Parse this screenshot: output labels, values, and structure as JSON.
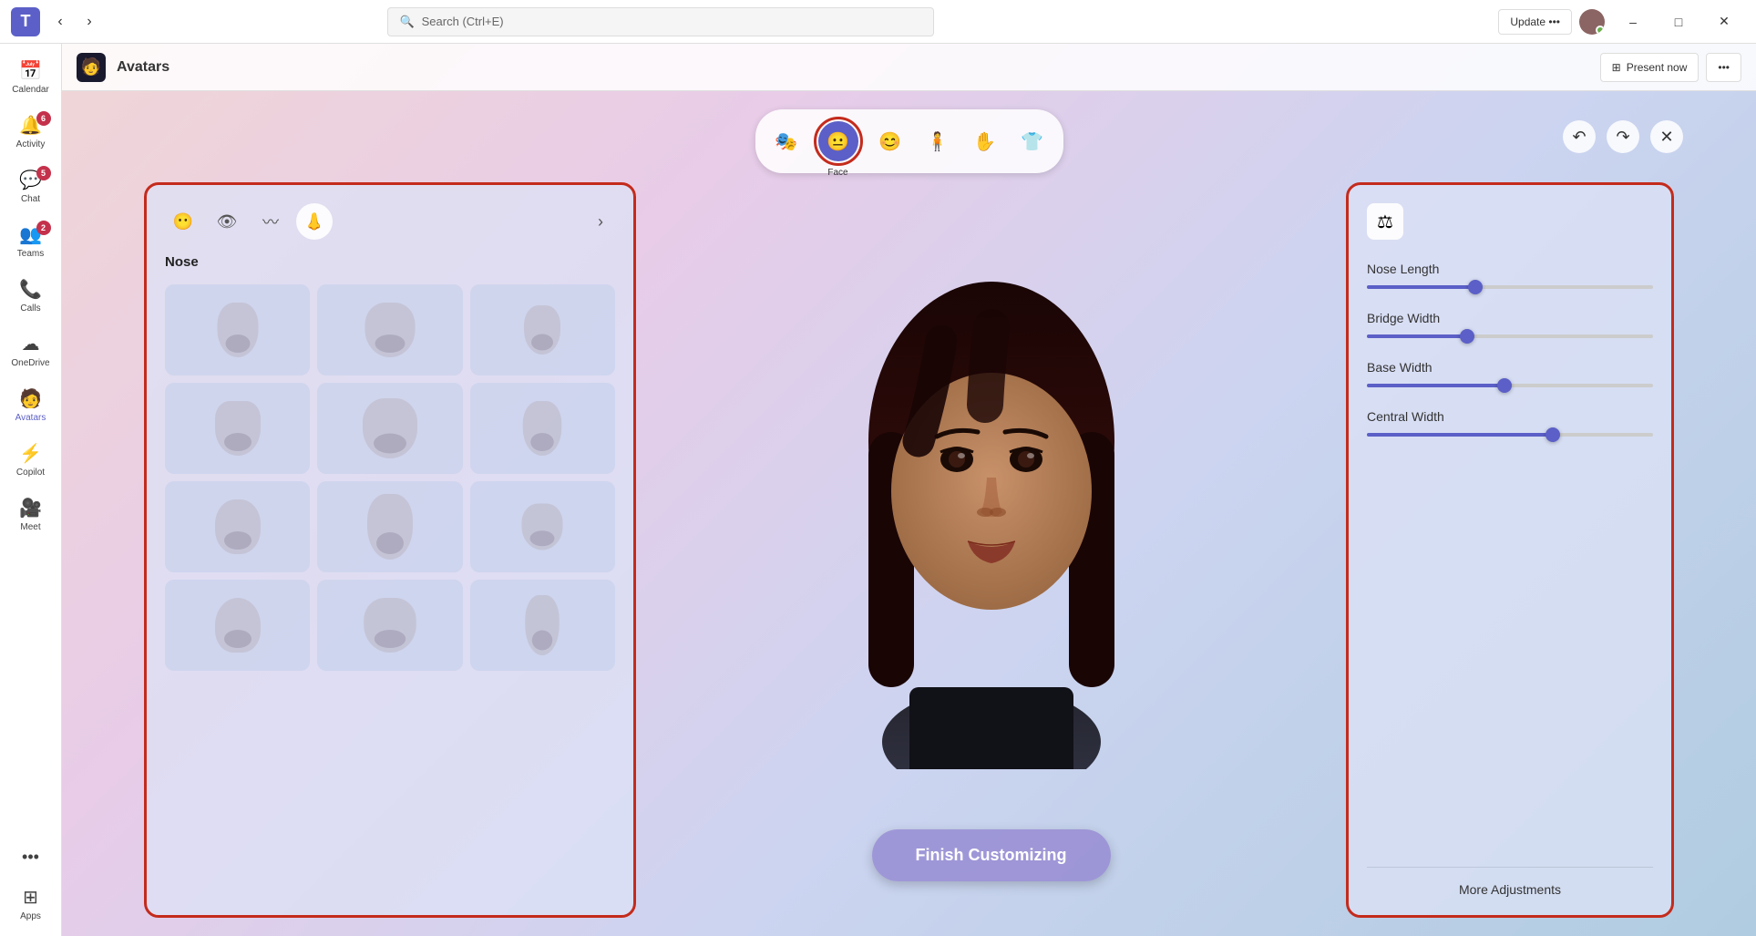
{
  "titlebar": {
    "search_placeholder": "Search (Ctrl+E)",
    "update_label": "Update •••",
    "minimize_label": "–",
    "maximize_label": "□",
    "close_label": "✕"
  },
  "sidebar": {
    "items": [
      {
        "id": "calendar",
        "label": "Calendar",
        "icon": "📅",
        "badge": null
      },
      {
        "id": "activity",
        "label": "Activity",
        "icon": "🔔",
        "badge": "6"
      },
      {
        "id": "chat",
        "label": "Chat",
        "icon": "💬",
        "badge": "5"
      },
      {
        "id": "teams",
        "label": "Teams",
        "icon": "👥",
        "badge": "2"
      },
      {
        "id": "calls",
        "label": "Calls",
        "icon": "📞",
        "badge": null
      },
      {
        "id": "onedrive",
        "label": "OneDrive",
        "icon": "☁",
        "badge": null
      },
      {
        "id": "avatars",
        "label": "Avatars",
        "icon": "🧑",
        "badge": null,
        "active": true
      },
      {
        "id": "copilot",
        "label": "Copilot",
        "icon": "⚡",
        "badge": null
      },
      {
        "id": "meet",
        "label": "Meet",
        "icon": "🎥",
        "badge": null
      },
      {
        "id": "apps",
        "label": "Apps",
        "icon": "⊞",
        "badge": null
      }
    ],
    "more_label": "•••"
  },
  "header": {
    "app_icon": "🧑",
    "title": "Avatars",
    "present_now_label": "Present now",
    "more_icon": "•••"
  },
  "category_tabs": [
    {
      "id": "preset",
      "icon": "🎭",
      "label": "",
      "active": false
    },
    {
      "id": "face",
      "icon": "😐",
      "label": "Face",
      "active": true
    },
    {
      "id": "expressions",
      "icon": "😊",
      "label": "",
      "active": false
    },
    {
      "id": "body",
      "icon": "🧍",
      "label": "",
      "active": false
    },
    {
      "id": "gestures",
      "icon": "✋",
      "label": "",
      "active": false
    },
    {
      "id": "clothing",
      "icon": "👕",
      "label": "",
      "active": false
    }
  ],
  "action_icons": [
    {
      "id": "undo",
      "icon": "↶"
    },
    {
      "id": "redo",
      "icon": "↷"
    },
    {
      "id": "close",
      "icon": "✕"
    }
  ],
  "left_panel": {
    "sub_tabs": [
      {
        "id": "face-shape",
        "icon": "😶",
        "active": false
      },
      {
        "id": "eyes",
        "icon": "👁",
        "active": false
      },
      {
        "id": "eyebrows",
        "icon": "〰",
        "active": false
      },
      {
        "id": "nose",
        "icon": "👃",
        "active": true
      }
    ],
    "section_title": "Nose",
    "nose_options": [
      {
        "id": 1
      },
      {
        "id": 2
      },
      {
        "id": 3
      },
      {
        "id": 4
      },
      {
        "id": 5
      },
      {
        "id": 6
      },
      {
        "id": 7
      },
      {
        "id": 8
      },
      {
        "id": 9
      },
      {
        "id": 10
      },
      {
        "id": 11
      },
      {
        "id": 12
      }
    ]
  },
  "right_panel": {
    "sliders": [
      {
        "id": "nose-length",
        "label": "Nose Length",
        "value": 38
      },
      {
        "id": "bridge-width",
        "label": "Bridge Width",
        "value": 35
      },
      {
        "id": "base-width",
        "label": "Base Width",
        "value": 48
      },
      {
        "id": "central-width",
        "label": "Central Width",
        "value": 65
      }
    ],
    "more_adjustments_label": "More Adjustments"
  },
  "finish_button": {
    "label": "Finish Customizing"
  }
}
